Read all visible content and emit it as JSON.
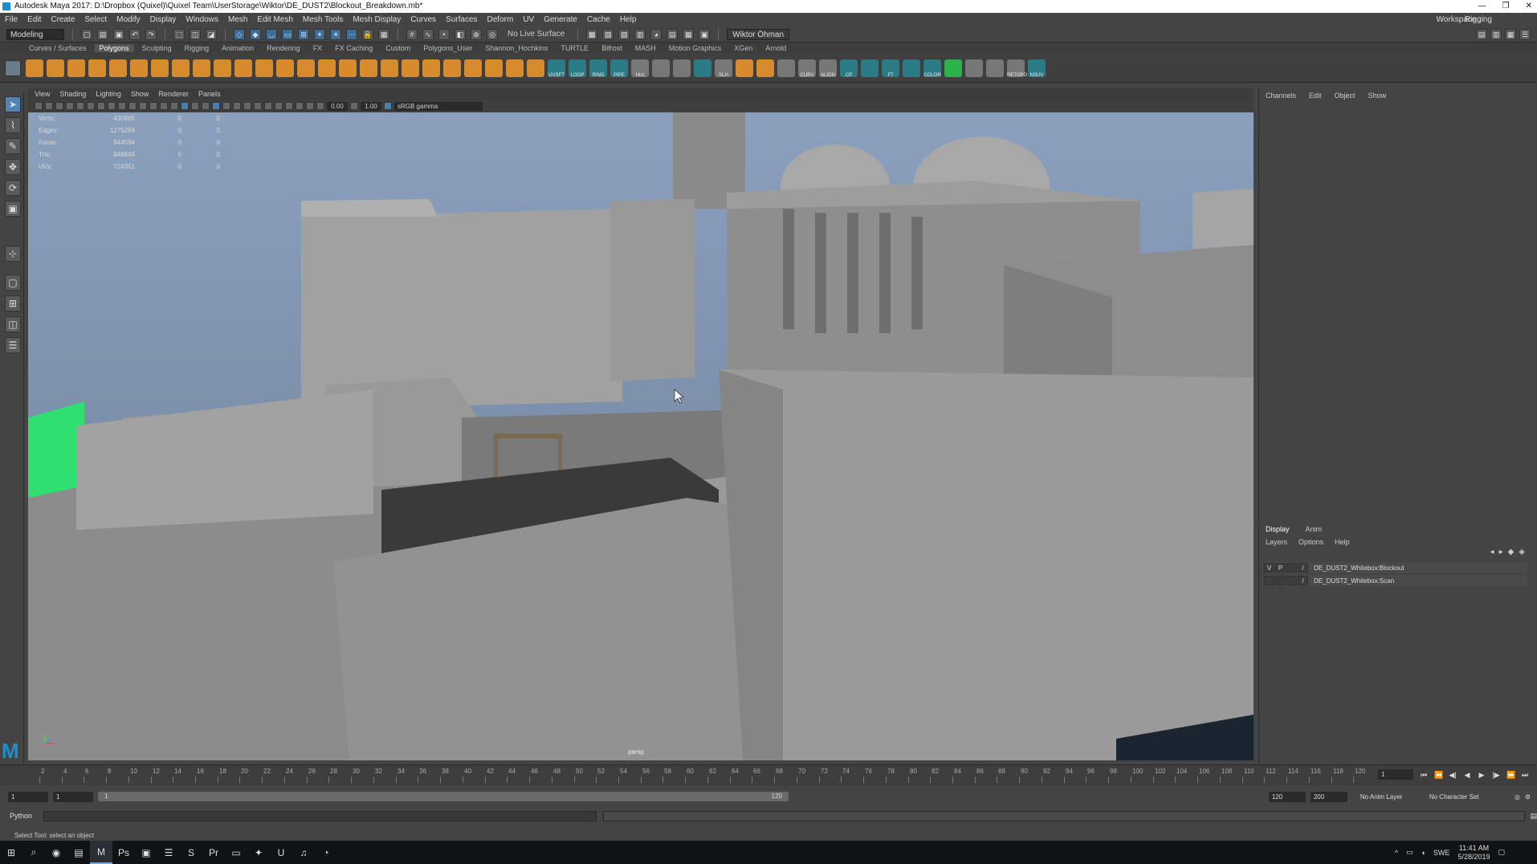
{
  "window": {
    "title": "Autodesk Maya 2017: D:\\Dropbox (Quixel)\\Quixel Team\\UserStorage\\Wiktor\\DE_DUST2\\Blockout_Breakdown.mb*",
    "min": "—",
    "max": "❐",
    "close": "✕"
  },
  "menubar": {
    "items": [
      "File",
      "Edit",
      "Create",
      "Select",
      "Modify",
      "Display",
      "Windows",
      "Mesh",
      "Edit Mesh",
      "Mesh Tools",
      "Mesh Display",
      "Curves",
      "Surfaces",
      "Deform",
      "UV",
      "Generate",
      "Cache",
      "Help"
    ],
    "workspace_label": "Workspace :",
    "workspace_value": "Rigging"
  },
  "statusline": {
    "mode": "Modeling",
    "live_surface": "No Live Surface",
    "user": "Wiktor Öhman"
  },
  "shelf_tabs": {
    "items": [
      "Curves / Surfaces",
      "Polygons",
      "Sculpting",
      "Rigging",
      "Animation",
      "Rendering",
      "FX",
      "FX Caching",
      "Custom",
      "Polygons_User",
      "Shannon_Hochkins",
      "TURTLE",
      "Bifrost",
      "MASH",
      "Motion Graphics",
      "XGen",
      "Arnold"
    ],
    "active": "Polygons"
  },
  "shelf": {
    "labels": [
      "UVSFT",
      "LOOP",
      "RING",
      "PIPE",
      "Hist",
      "SLH",
      "CURV",
      "ALIGN",
      "CP",
      "FT",
      "COLOR",
      "RETOPO",
      "NSUV"
    ]
  },
  "viewport": {
    "menu": [
      "View",
      "Shading",
      "Lighting",
      "Show",
      "Renderer",
      "Panels"
    ],
    "exposure": "0.00",
    "gamma": "1.00",
    "color_space": "sRGB gamma",
    "camera": "persp",
    "hud": [
      {
        "label": "Verts:",
        "v1": "430865",
        "v2": "0",
        "v3": "0"
      },
      {
        "label": "Edges:",
        "v1": "1275264",
        "v2": "0",
        "v3": "0"
      },
      {
        "label": "Faces:",
        "v1": "844594",
        "v2": "0",
        "v3": "0"
      },
      {
        "label": "Tris:",
        "v1": "848844",
        "v2": "0",
        "v3": "0"
      },
      {
        "label": "UVs:",
        "v1": "724351",
        "v2": "0",
        "v3": "0"
      }
    ]
  },
  "channelbox": {
    "menu": [
      "Channels",
      "Edit",
      "Object",
      "Show"
    ]
  },
  "layer_editor": {
    "tabs": [
      "Display",
      "Anim"
    ],
    "menu": [
      "Layers",
      "Options",
      "Help"
    ],
    "layers": [
      {
        "v": "V",
        "p": "P",
        "name": "DE_DUST2_Whitebox:Blockout"
      },
      {
        "v": "",
        "p": "",
        "name": "DE_DUST2_Whitebox:Scan"
      }
    ]
  },
  "timeline": {
    "ticks": [
      "2",
      "4",
      "6",
      "8",
      "10",
      "12",
      "14",
      "16",
      "18",
      "20",
      "22",
      "24",
      "26",
      "28",
      "30",
      "32",
      "34",
      "36",
      "38",
      "40",
      "42",
      "44",
      "46",
      "48",
      "50",
      "52",
      "54",
      "56",
      "58",
      "60",
      "62",
      "64",
      "66",
      "68",
      "70",
      "72",
      "74",
      "76",
      "78",
      "80",
      "82",
      "84",
      "86",
      "88",
      "90",
      "92",
      "94",
      "96",
      "98",
      "100",
      "102",
      "104",
      "106",
      "108",
      "110",
      "112",
      "114",
      "116",
      "118",
      "120"
    ],
    "current_frame": "1"
  },
  "range": {
    "start": "1",
    "playback_start": "1",
    "slider_start": "1",
    "slider_end": "120",
    "playback_end": "120",
    "end": "200",
    "anim_layer": "No Anim Layer",
    "char_set": "No Character Set"
  },
  "cmdline": {
    "label": "Python"
  },
  "helpline": {
    "text": "Select Tool: select an object"
  },
  "taskbar": {
    "apps": [
      "⊞",
      "⌕",
      "◉",
      "▤",
      "M",
      "Ps",
      "▣",
      "☰",
      "S",
      "Pr",
      "▭",
      "✦",
      "U",
      "♫",
      "◔"
    ],
    "lang": "SWE",
    "time": "11:41 AM",
    "date": "5/28/2019"
  }
}
